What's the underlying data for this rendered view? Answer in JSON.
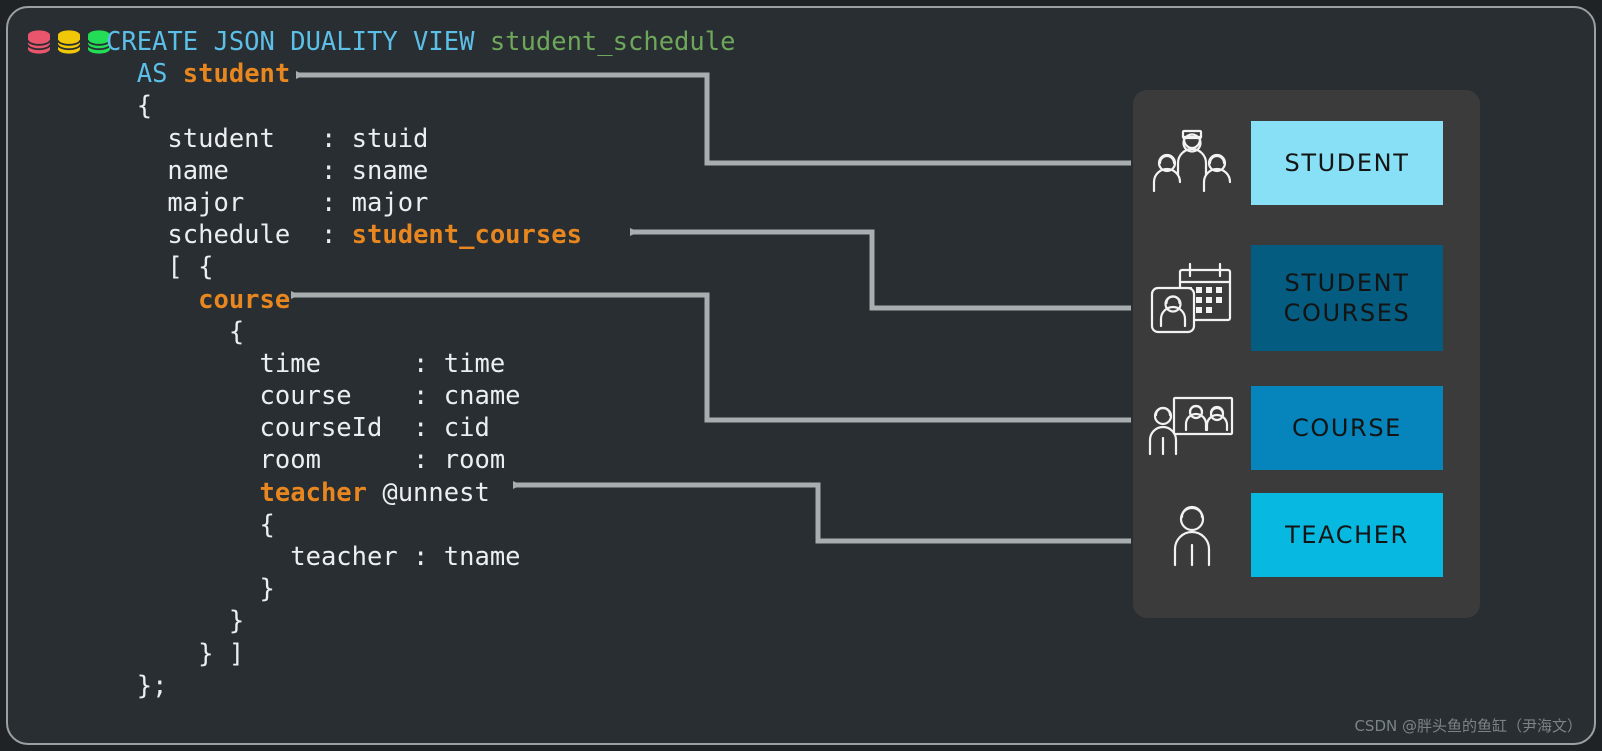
{
  "window": {
    "background_color": "#1f2326",
    "panel_color": "#282e31",
    "panel_border_color": "#9aa0a4"
  },
  "db_icons": [
    {
      "name": "database-icon-red",
      "color": "#e8556d"
    },
    {
      "name": "database-icon-yellow",
      "color": "#f0c808"
    },
    {
      "name": "database-icon-green",
      "color": "#22dd55"
    }
  ],
  "code": {
    "language": "sql",
    "colors": {
      "keyword": "#5bbfe8",
      "view_name": "#6fa75a",
      "identifier": "#e8861f",
      "plain": "#eceff1"
    },
    "lines": [
      {
        "indent": 0,
        "tokens": [
          {
            "t": "CREATE JSON DUALITY VIEW ",
            "c": "kw"
          },
          {
            "t": "student_schedule",
            "c": "name"
          }
        ]
      },
      {
        "indent": 1,
        "tokens": [
          {
            "t": "AS ",
            "c": "kw"
          },
          {
            "t": "student",
            "c": "ident"
          }
        ]
      },
      {
        "indent": 1,
        "tokens": [
          {
            "t": "{",
            "c": "plain"
          }
        ]
      },
      {
        "indent": 2,
        "tokens": [
          {
            "t": "student   : stuid",
            "c": "plain"
          }
        ]
      },
      {
        "indent": 2,
        "tokens": [
          {
            "t": "name      : sname",
            "c": "plain"
          }
        ]
      },
      {
        "indent": 2,
        "tokens": [
          {
            "t": "major     : major",
            "c": "plain"
          }
        ]
      },
      {
        "indent": 2,
        "tokens": [
          {
            "t": "schedule  : ",
            "c": "plain"
          },
          {
            "t": "student_courses",
            "c": "ident"
          }
        ]
      },
      {
        "indent": 2,
        "tokens": [
          {
            "t": "[ {",
            "c": "plain"
          }
        ]
      },
      {
        "indent": 3,
        "tokens": [
          {
            "t": "course",
            "c": "ident"
          }
        ]
      },
      {
        "indent": 4,
        "tokens": [
          {
            "t": "{",
            "c": "plain"
          }
        ]
      },
      {
        "indent": 5,
        "tokens": [
          {
            "t": "time      : time",
            "c": "plain"
          }
        ]
      },
      {
        "indent": 5,
        "tokens": [
          {
            "t": "course    : cname",
            "c": "plain"
          }
        ]
      },
      {
        "indent": 5,
        "tokens": [
          {
            "t": "courseId  : cid",
            "c": "plain"
          }
        ]
      },
      {
        "indent": 5,
        "tokens": [
          {
            "t": "room      : room",
            "c": "plain"
          }
        ]
      },
      {
        "indent": 5,
        "tokens": [
          {
            "t": "teacher",
            "c": "ident"
          },
          {
            "t": " @unnest",
            "c": "plain"
          }
        ]
      },
      {
        "indent": 5,
        "tokens": [
          {
            "t": "{",
            "c": "plain"
          }
        ]
      },
      {
        "indent": 6,
        "tokens": [
          {
            "t": "teacher : tname",
            "c": "plain"
          }
        ]
      },
      {
        "indent": 5,
        "tokens": [
          {
            "t": "}",
            "c": "plain"
          }
        ]
      },
      {
        "indent": 4,
        "tokens": [
          {
            "t": "}",
            "c": "plain"
          }
        ]
      },
      {
        "indent": 3,
        "tokens": [
          {
            "t": "} ]",
            "c": "plain"
          }
        ]
      },
      {
        "indent": 1,
        "tokens": [
          {
            "t": "};",
            "c": "plain"
          }
        ]
      }
    ]
  },
  "connectors": {
    "color": "#a8adaf",
    "items": [
      {
        "name": "connector-student",
        "target_label": "student"
      },
      {
        "name": "connector-student-courses",
        "target_label": "student_courses"
      },
      {
        "name": "connector-course",
        "target_label": "course"
      },
      {
        "name": "connector-teacher",
        "target_label": "teacher"
      }
    ]
  },
  "entities": {
    "panel_color": "#3b3b3b",
    "items": [
      {
        "id": "student",
        "label": "STUDENT",
        "label_line2": "",
        "color": "#87e0f5",
        "icon": "group-of-people-icon"
      },
      {
        "id": "student-courses",
        "label": "STUDENT",
        "label_line2": "COURSES",
        "color": "#045c80",
        "text_color": "#141414",
        "icon": "student-calendar-icon"
      },
      {
        "id": "course",
        "label": "COURSE",
        "label_line2": "",
        "color": "#0585bb",
        "icon": "classroom-icon"
      },
      {
        "id": "teacher",
        "label": "TEACHER",
        "label_line2": "",
        "color": "#07b8e0",
        "icon": "person-icon"
      }
    ]
  },
  "watermark": {
    "text": "CSDN @胖头鱼的鱼缸（尹海文）"
  }
}
